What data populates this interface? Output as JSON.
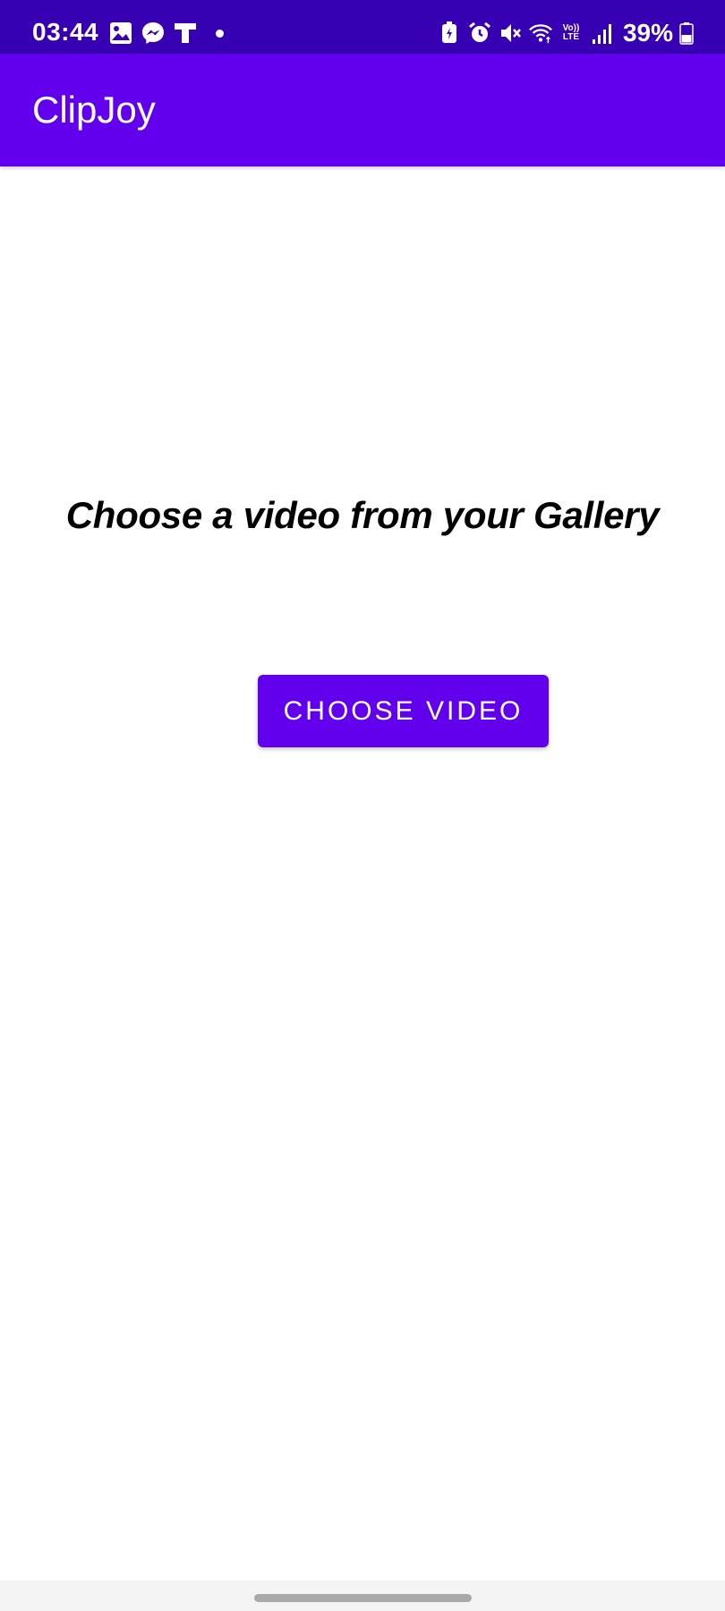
{
  "status_bar": {
    "time": "03:44",
    "battery_percent": "39%",
    "volte_line1": "Vo))",
    "volte_line2": "LTE",
    "left_icons": [
      "gallery-icon",
      "messenger-icon",
      "t-app-icon",
      "notification-dot-icon"
    ],
    "right_icons": [
      "battery-saver-icon",
      "alarm-icon",
      "mute-icon",
      "wifi-icon",
      "volte-icon",
      "signal-icon",
      "battery-icon"
    ]
  },
  "app_bar": {
    "title": "ClipJoy"
  },
  "main": {
    "prompt": "Choose a video from your Gallery",
    "choose_button_label": "CHOOSE VIDEO"
  },
  "colors": {
    "status_bar": "#3700b3",
    "primary": "#6200ee",
    "background": "#ffffff",
    "text": "#000000"
  }
}
